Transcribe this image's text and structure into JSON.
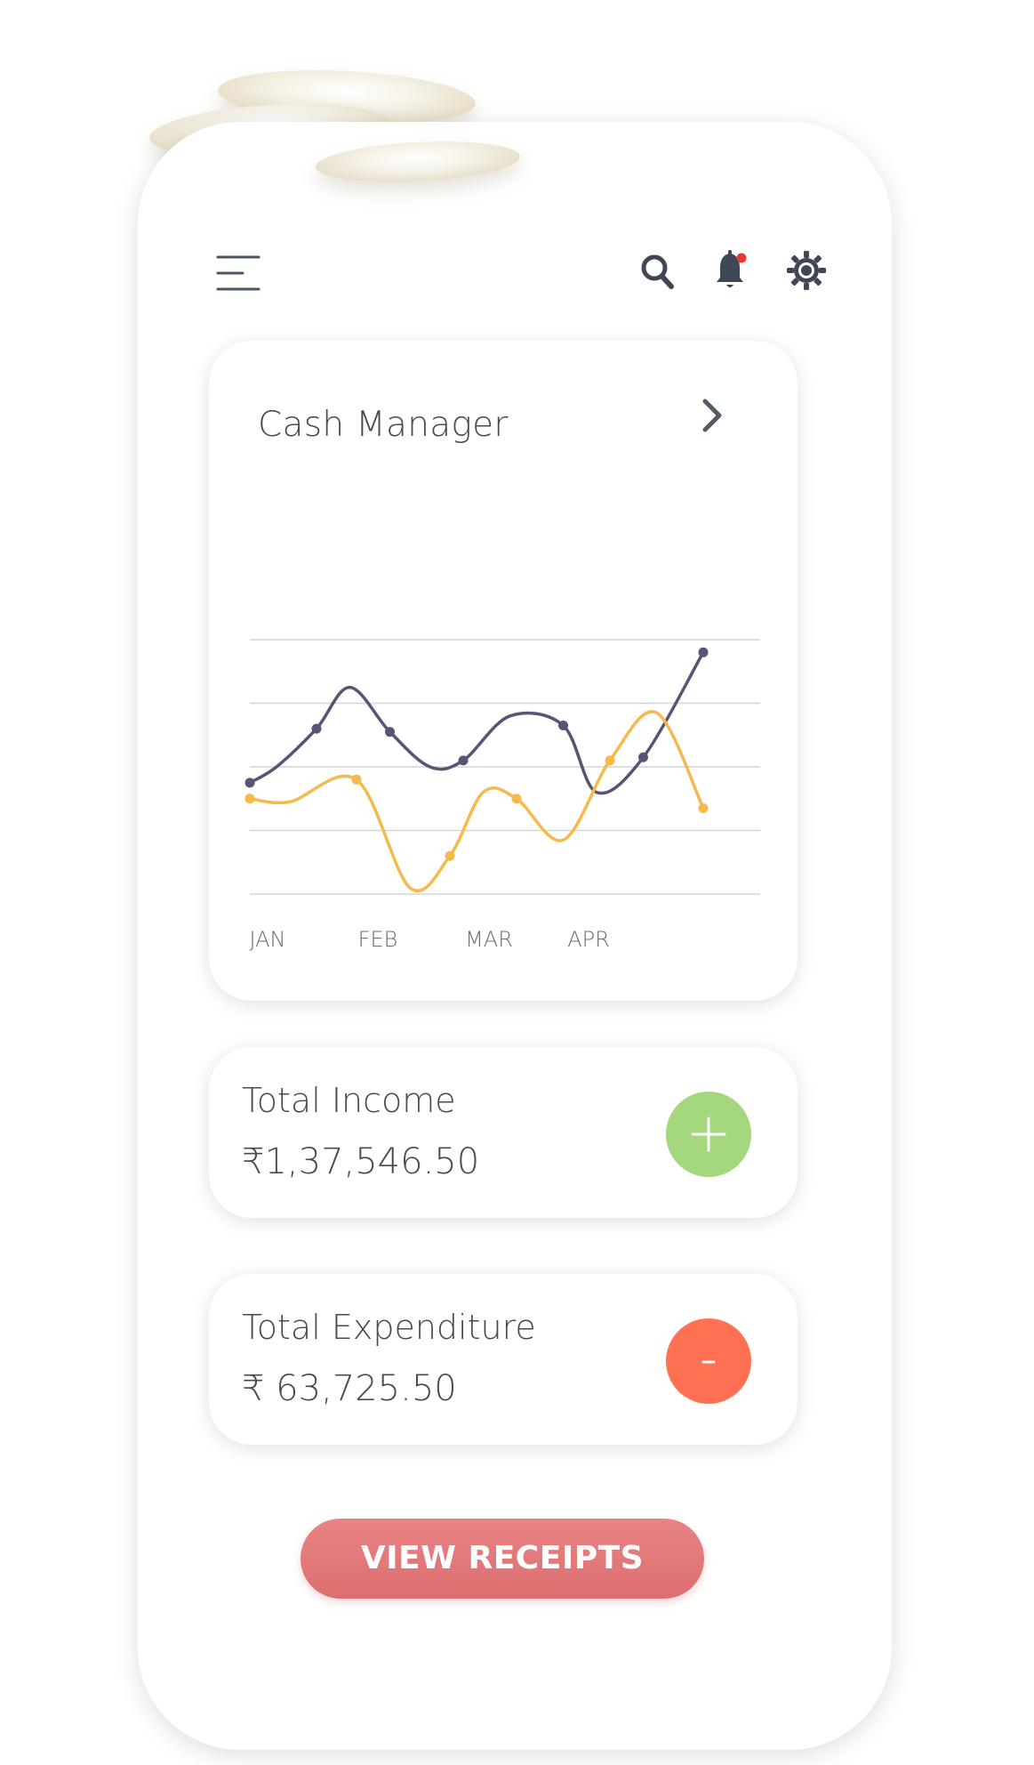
{
  "header": {
    "menu_icon": "hamburger-menu-icon",
    "search_icon": "search-icon",
    "notification_icon": "bell-icon",
    "notification_dot_color": "#e53935",
    "settings_icon": "gear-icon"
  },
  "cash_manager": {
    "title": "Cash Manager",
    "chevron_icon": "chevron-right-icon"
  },
  "chart_data": {
    "type": "line",
    "title": "Cash Manager",
    "categories": [
      "JAN",
      "FEB",
      "MAR",
      "APR"
    ],
    "grid": true,
    "legend": "none",
    "ylim": [
      0,
      4
    ],
    "series": [
      {
        "color": "#5a5373",
        "x": [
          0,
          0.5,
          1.05,
          1.6,
          2.35,
          2.95,
          3.4
        ],
        "y": [
          1.75,
          2.6,
          2.55,
          2.1,
          2.65,
          2.15,
          3.8
        ],
        "curve": [
          [
            0,
            1.75
          ],
          [
            0.2,
            2.0
          ],
          [
            0.5,
            2.6
          ],
          [
            0.75,
            3.25
          ],
          [
            1.05,
            2.55
          ],
          [
            1.35,
            2.0
          ],
          [
            1.6,
            2.1
          ],
          [
            1.95,
            2.8
          ],
          [
            2.35,
            2.65
          ],
          [
            2.6,
            1.6
          ],
          [
            2.95,
            2.15
          ],
          [
            3.4,
            3.8
          ]
        ]
      },
      {
        "color": "#f6b94b",
        "x": [
          0,
          0.8,
          1.5,
          2.0,
          2.7,
          3.4
        ],
        "y": [
          1.5,
          1.8,
          0.6,
          1.5,
          2.1,
          1.35
        ],
        "curve": [
          [
            0,
            1.5
          ],
          [
            0.3,
            1.45
          ],
          [
            0.8,
            1.8
          ],
          [
            1.2,
            0.1
          ],
          [
            1.5,
            0.6
          ],
          [
            1.75,
            1.6
          ],
          [
            2.0,
            1.5
          ],
          [
            2.35,
            0.85
          ],
          [
            2.7,
            2.1
          ],
          [
            3.05,
            2.85
          ],
          [
            3.4,
            1.35
          ]
        ]
      }
    ]
  },
  "income": {
    "label": "Total Income",
    "value": "₹1,37,546.50",
    "action_icon": "plus-icon",
    "color": "#a5d87e"
  },
  "expenditure": {
    "label": "Total Expenditure",
    "value": "₹ 63,725.50",
    "action_icon": "minus-icon",
    "color": "#ff7152"
  },
  "actions": {
    "view_receipts": "VIEW RECEIPTS"
  }
}
